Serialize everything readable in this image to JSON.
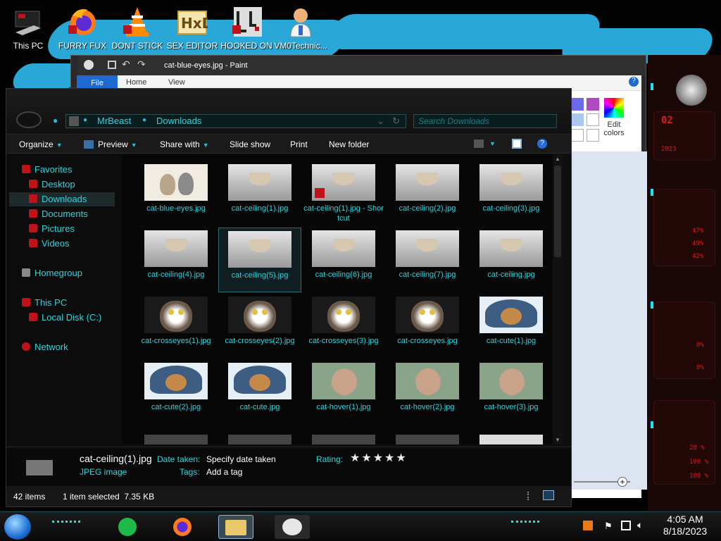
{
  "desktop": {
    "icons": [
      {
        "label": "This PC",
        "icon": "computer-icon"
      },
      {
        "label": "FURRY FUX",
        "icon": "firefox-icon"
      },
      {
        "label": "DONT STICK",
        "icon": "vlc-icon"
      },
      {
        "label": "SEX EDITOR",
        "icon": "hex-editor-icon"
      },
      {
        "label": "HOOKED ON",
        "icon": "maze-icon"
      },
      {
        "label": "VM0Technic...",
        "icon": "doctor-icon"
      }
    ]
  },
  "gadget": {
    "readouts": [
      "02",
      "2023",
      "47%",
      "49%",
      "42%",
      "0%",
      "0%",
      "28 %",
      "100 %",
      "100 %"
    ]
  },
  "paint": {
    "title": "cat-blue-eyes.jpg - Paint",
    "tabs": [
      "File",
      "Home",
      "View"
    ],
    "edit_colors": "Edit colors"
  },
  "explorer": {
    "breadcrumb": [
      "MrBeast",
      "Downloads"
    ],
    "search_placeholder": "Search Downloads",
    "commands": [
      "Organize",
      "Preview",
      "Share with",
      "Slide show",
      "Print",
      "New folder"
    ],
    "nav": {
      "favorites": "Favorites",
      "desktop": "Desktop",
      "downloads": "Downloads",
      "documents": "Documents",
      "pictures": "Pictures",
      "videos": "Videos",
      "homegroup": "Homegroup",
      "this_pc": "This PC",
      "local_disk": "Local Disk (C:)",
      "network": "Network"
    },
    "files": [
      {
        "name": "cat-blue-eyes.jpg",
        "thumb": "kittens"
      },
      {
        "name": "cat-ceiling(1).jpg",
        "thumb": "ceiling"
      },
      {
        "name": "cat-ceiling(1).jpg - Shortcut",
        "thumb": "ceiling-shortcut"
      },
      {
        "name": "cat-ceiling(2).jpg",
        "thumb": "ceiling"
      },
      {
        "name": "cat-ceiling(3).jpg",
        "thumb": "ceiling"
      },
      {
        "name": "cat-ceiling(4).jpg",
        "thumb": "ceiling"
      },
      {
        "name": "cat-ceiling(5).jpg",
        "thumb": "ceiling"
      },
      {
        "name": "cat-ceiling(6).jpg",
        "thumb": "ceiling"
      },
      {
        "name": "cat-ceiling(7).jpg",
        "thumb": "ceiling"
      },
      {
        "name": "cat-ceiling.jpg",
        "thumb": "ceiling"
      },
      {
        "name": "cat-crosseyes(1).jpg",
        "thumb": "crosseyes"
      },
      {
        "name": "cat-crosseyes(2).jpg",
        "thumb": "crosseyes"
      },
      {
        "name": "cat-crosseyes(3).jpg",
        "thumb": "crosseyes"
      },
      {
        "name": "cat-crosseyes.jpg",
        "thumb": "crosseyes"
      },
      {
        "name": "cat-cute(1).jpg",
        "thumb": "cute"
      },
      {
        "name": "cat-cute(2).jpg",
        "thumb": "cute"
      },
      {
        "name": "cat-cute.jpg",
        "thumb": "cute"
      },
      {
        "name": "cat-hover(1).jpg",
        "thumb": "hover"
      },
      {
        "name": "cat-hover(2).jpg",
        "thumb": "hover"
      },
      {
        "name": "cat-hover(3).jpg",
        "thumb": "hover"
      }
    ],
    "selected_index": 6,
    "details": {
      "filename": "cat-ceiling(1).jpg",
      "filetype": "JPEG image",
      "date_taken_label": "Date taken:",
      "date_taken_value": "Specify date taken",
      "tags_label": "Tags:",
      "tags_value": "Add a tag",
      "rating_label": "Rating:",
      "stars": "★★★★★"
    },
    "status": {
      "count": "42 items",
      "selection": "1 item selected  7.35 KB"
    }
  },
  "taskbar": {
    "time": "4:05 AM",
    "date": "8/18/2023"
  },
  "colors": {
    "accent": "#2fd4dc",
    "wallpaper_blue": "#29a7d6",
    "gadget_red": "#e01a1a"
  }
}
